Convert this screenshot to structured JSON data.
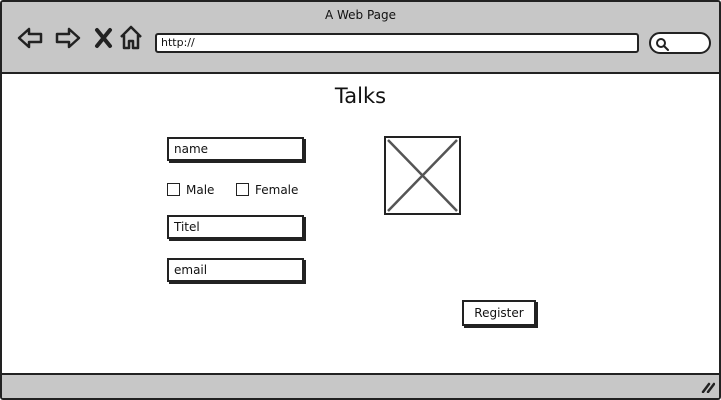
{
  "window": {
    "title": "A Web Page"
  },
  "browser": {
    "url": "http://",
    "nav_icons": [
      "back-arrow-icon",
      "forward-arrow-icon",
      "close-x-icon",
      "home-icon"
    ],
    "search_icon": "search-icon"
  },
  "page": {
    "title": "Talks",
    "form": {
      "name_value": "name",
      "gender_options": [
        "Male",
        "Female"
      ],
      "title_value": "Titel",
      "email_value": "email",
      "register_label": "Register"
    },
    "image": "image-placeholder"
  },
  "colors": {
    "chrome": "#c7c7c7",
    "ink": "#222222",
    "background": "#ffffff"
  }
}
